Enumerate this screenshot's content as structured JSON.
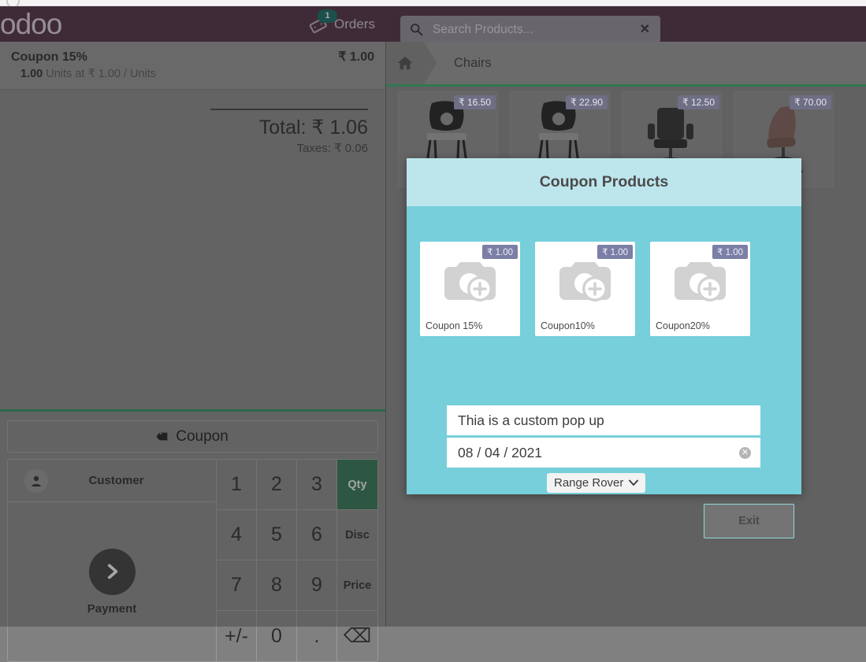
{
  "topbar": {
    "logo_text": "odoo",
    "orders_label": "Orders",
    "orders_badge": "1",
    "orders_icon": "ticket-icon",
    "search_placeholder": "Search Products...",
    "search_value": "",
    "search_icon": "search-icon",
    "search_clear_icon": "close-icon",
    "background_color": "#4b2c3f"
  },
  "order": {
    "lines": [
      {
        "name": "Coupon 15%",
        "price": "₹ 1.00",
        "qty": "1.00",
        "detail": " Units at ₹ 1.00 / Units"
      }
    ],
    "total_label": "Total: ₹ 1.06",
    "taxes_label": "Taxes: ₹ 0.06"
  },
  "actions": {
    "coupon_label": "Coupon",
    "coupon_icon": "tag-icon"
  },
  "numpad": {
    "customer_label": "Customer",
    "customer_icon": "user-icon",
    "payment_label": "Payment",
    "payment_icon": "chevron-right-icon",
    "keys": [
      {
        "label": "1",
        "mode": false,
        "active": false
      },
      {
        "label": "2",
        "mode": false,
        "active": false
      },
      {
        "label": "3",
        "mode": false,
        "active": false
      },
      {
        "label": "Qty",
        "mode": true,
        "active": true
      },
      {
        "label": "4",
        "mode": false,
        "active": false
      },
      {
        "label": "5",
        "mode": false,
        "active": false
      },
      {
        "label": "6",
        "mode": false,
        "active": false
      },
      {
        "label": "Disc",
        "mode": true,
        "active": false
      },
      {
        "label": "7",
        "mode": false,
        "active": false
      },
      {
        "label": "8",
        "mode": false,
        "active": false
      },
      {
        "label": "9",
        "mode": false,
        "active": false
      },
      {
        "label": "Price",
        "mode": true,
        "active": false
      },
      {
        "label": "+/-",
        "mode": false,
        "active": false
      },
      {
        "label": "0",
        "mode": false,
        "active": false
      },
      {
        "label": ".",
        "mode": false,
        "active": false
      },
      {
        "label": "⌫",
        "mode": false,
        "active": false
      }
    ],
    "active_mode_color": "#2f7050"
  },
  "breadcrumb": {
    "home_icon": "home-icon",
    "category": "Chairs",
    "underline_color": "#38a06a"
  },
  "products": [
    {
      "price": "₹ 16.50",
      "image": "black-stacking-chair"
    },
    {
      "price": "₹ 22.90",
      "image": "black-stacking-chair"
    },
    {
      "price": "₹ 12.50",
      "image": "black-office-chair"
    },
    {
      "price": "₹ 70.00",
      "image": "brown-office-chair"
    }
  ],
  "dialog": {
    "title": "Coupon Products",
    "header_color": "#bde5ec",
    "body_color": "#76cfdb",
    "coupon_products": [
      {
        "name": "Coupon 15%",
        "price": "₹ 1.00",
        "image": "image-placeholder-icon"
      },
      {
        "name": "Coupon10%",
        "price": "₹ 1.00",
        "image": "image-placeholder-icon"
      },
      {
        "name": "Coupon20%",
        "price": "₹ 1.00",
        "image": "image-placeholder-icon"
      }
    ],
    "text_input": {
      "value": "Thia is a custom pop up",
      "placeholder": ""
    },
    "date_input": {
      "value": "08 / 04 / 2021",
      "placeholder": "",
      "clear_icon": "clear-circle-icon"
    },
    "select": {
      "value": "Range Rover",
      "chevron_icon": "chevron-down-icon",
      "options": [
        "Range Rover"
      ]
    },
    "exit_label": "Exit"
  }
}
